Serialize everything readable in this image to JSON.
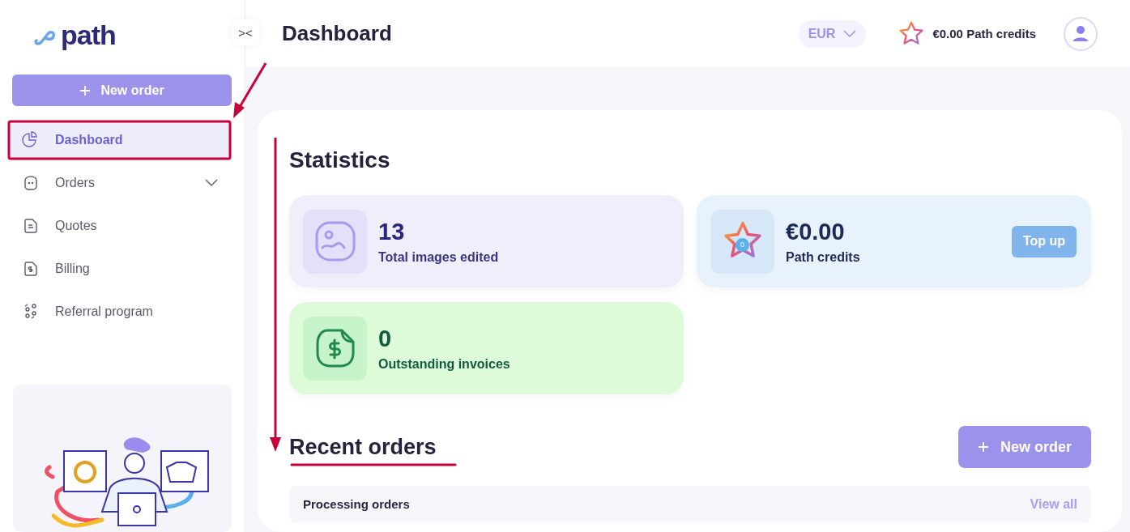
{
  "sidebar": {
    "logo": "path",
    "collapse_icon": "><",
    "new_order": "New order",
    "items": [
      {
        "label": "Dashboard",
        "selected": true
      },
      {
        "label": "Orders",
        "selected": false,
        "expanded": false
      },
      {
        "label": "Quotes",
        "selected": false
      },
      {
        "label": "Billing",
        "selected": false
      },
      {
        "label": "Referral program",
        "selected": false
      }
    ]
  },
  "header": {
    "title": "Dashboard",
    "currency": "EUR",
    "credits": "€0.00 Path credits"
  },
  "statistics": {
    "title": "Statistics",
    "cards": [
      {
        "kind": "images",
        "value": "13",
        "label": "Total images edited"
      },
      {
        "kind": "credits",
        "value": "€0.00",
        "label": "Path credits",
        "badge": "0",
        "action": "Top up"
      },
      {
        "kind": "invoices",
        "value": "0",
        "label": "Outstanding invoices"
      }
    ]
  },
  "recent_orders": {
    "title": "Recent orders",
    "new_order": "New order",
    "section": "Processing orders",
    "view_all": "View all"
  }
}
